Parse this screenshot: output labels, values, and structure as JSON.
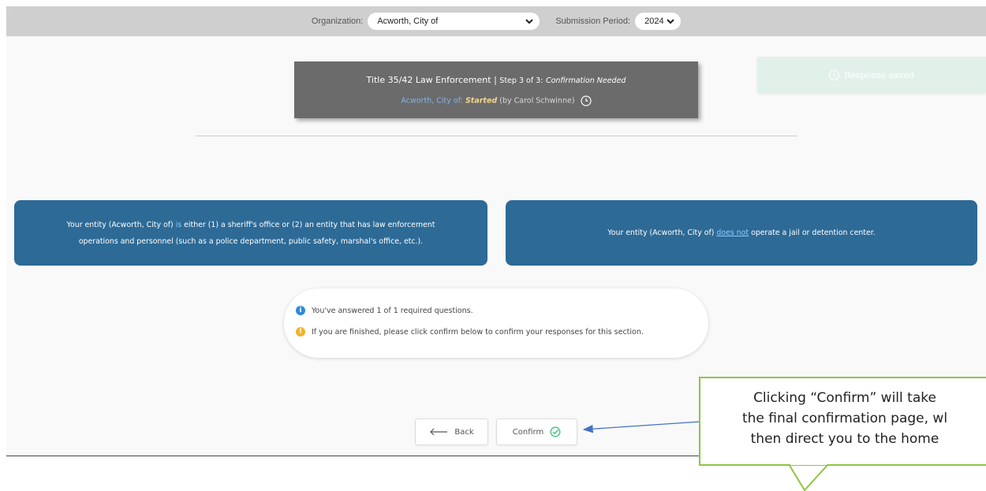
{
  "topbar": {
    "organization_label": "Organization:",
    "organization_value": "Acworth, City of",
    "period_label": "Submission Period:",
    "period_value": "2024"
  },
  "header_card": {
    "title": "Title 35/42 Law Enforcement",
    "separator": "|",
    "step": "Step 3 of 3:",
    "step_status": "Confirmation Needed",
    "org_prefix": "Acworth, City of:",
    "status": "Started",
    "by": "(by Carol Schwinne)"
  },
  "toast": {
    "icon": "info-icon",
    "text": "Response saved"
  },
  "answers": {
    "left": {
      "prefix": "Your entity (Acworth, City of)",
      "keyword": "is",
      "line1_rest": "either (1) a sheriff's office or (2) an entity that has law enforcement",
      "line2": "operations and personnel (such as a police department, public safety, marshal's office, etc.)."
    },
    "right": {
      "prefix": "Your entity (Acworth, City of)",
      "keyword": "does not",
      "rest": "operate a jail or detention center."
    }
  },
  "summary": {
    "info_text": "You've answered 1 of 1 required questions.",
    "warn_text": "If you are finished, please click confirm below to confirm your responses for this section."
  },
  "buttons": {
    "back": "Back",
    "confirm": "Confirm"
  },
  "callout": {
    "line1": "Clicking “Confirm” will take",
    "line2": "the final confirmation page, wl",
    "line3": "then direct you to the home"
  },
  "colors": {
    "card_blue": "#2d6a96",
    "callout_border": "#8dc63f",
    "arrow": "#4472c4",
    "confirm_check": "#3fbf7f"
  }
}
